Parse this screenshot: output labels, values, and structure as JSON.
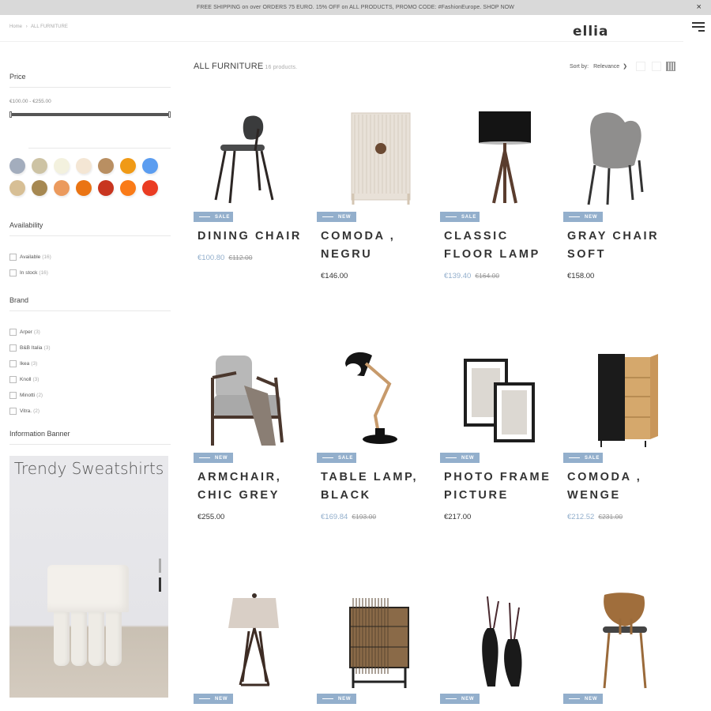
{
  "promo": {
    "text": "FREE SHIPPING on over ORDERS 75 EURO. 15% OFF on ALL PRODUCTS, PROMO CODE: #FashionEurope. SHOP NOW",
    "close": "×"
  },
  "header": {
    "breadcrumb": [
      "Home",
      "ALL FURNITURE"
    ],
    "separator": "›",
    "logo": "ellia"
  },
  "sidebar": {
    "price": {
      "title": "Price",
      "range": "€100.00 - €255.00",
      "min": 100,
      "max": 255
    },
    "colors": [
      "#a3adbd",
      "#cdc3a4",
      "#f3f1de",
      "#f4e6d4",
      "#b98f62",
      "#f09a16",
      "#5b9df0",
      "#d7bf95",
      "#a68851",
      "#eb9a5d",
      "#ea7413",
      "#c8351f",
      "#fa7b18",
      "#ea3c22"
    ],
    "availability": {
      "title": "Availability",
      "items": [
        {
          "label": "Available",
          "count": "(16)"
        },
        {
          "label": "In stock",
          "count": "(16)"
        }
      ]
    },
    "brand": {
      "title": "Brand",
      "items": [
        {
          "label": "Arper",
          "count": "(3)"
        },
        {
          "label": "B&B Italia",
          "count": "(3)"
        },
        {
          "label": "Ikea",
          "count": "(3)"
        },
        {
          "label": "Knoll",
          "count": "(3)"
        },
        {
          "label": "Minotti",
          "count": "(2)"
        },
        {
          "label": "Vitra.",
          "count": "(2)"
        }
      ]
    },
    "banner": {
      "title": "Information Banner",
      "heading": "Trendy Sweatshirts"
    }
  },
  "listing": {
    "title": "ALL FURNITURE",
    "count": "16 products.",
    "sort_label": "Sort by:",
    "sort_value": "Relevance",
    "chevron": "⌄",
    "products": [
      {
        "badge": "SALE",
        "name": "DINING CHAIR",
        "price": "€100.80",
        "old": "€112.00",
        "icon": "dining-chair"
      },
      {
        "badge": "NEW",
        "name": "COMODA , NEGRU",
        "price": "€146.00",
        "old": "",
        "icon": "cabinet"
      },
      {
        "badge": "SALE",
        "name": "CLASSIC FLOOR LAMP",
        "price": "€139.40",
        "old": "€164.00",
        "icon": "floor-lamp"
      },
      {
        "badge": "NEW",
        "name": "GRAY CHAIR SOFT",
        "price": "€158.00",
        "old": "",
        "icon": "gray-chair"
      },
      {
        "badge": "NEW",
        "name": "ARMCHAIR, CHIC GREY",
        "price": "€255.00",
        "old": "",
        "icon": "armchair"
      },
      {
        "badge": "SALE",
        "name": "TABLE LAMP, BLACK",
        "price": "€169.84",
        "old": "€193.00",
        "icon": "table-lamp"
      },
      {
        "badge": "NEW",
        "name": "PHOTO FRAME PICTURE",
        "price": "€217.00",
        "old": "",
        "icon": "photo-frame"
      },
      {
        "badge": "SALE",
        "name": "COMODA , WENGE",
        "price": "€212.52",
        "old": "€231.00",
        "icon": "wardrobe"
      },
      {
        "badge": "NEW",
        "name": "",
        "price": "",
        "old": "",
        "icon": "table-lamp-shade"
      },
      {
        "badge": "NEW",
        "name": "",
        "price": "",
        "old": "",
        "icon": "bar-cabinet"
      },
      {
        "badge": "NEW",
        "name": "",
        "price": "",
        "old": "",
        "icon": "vases"
      },
      {
        "badge": "NEW",
        "name": "",
        "price": "",
        "old": "",
        "icon": "wood-chair"
      }
    ]
  }
}
